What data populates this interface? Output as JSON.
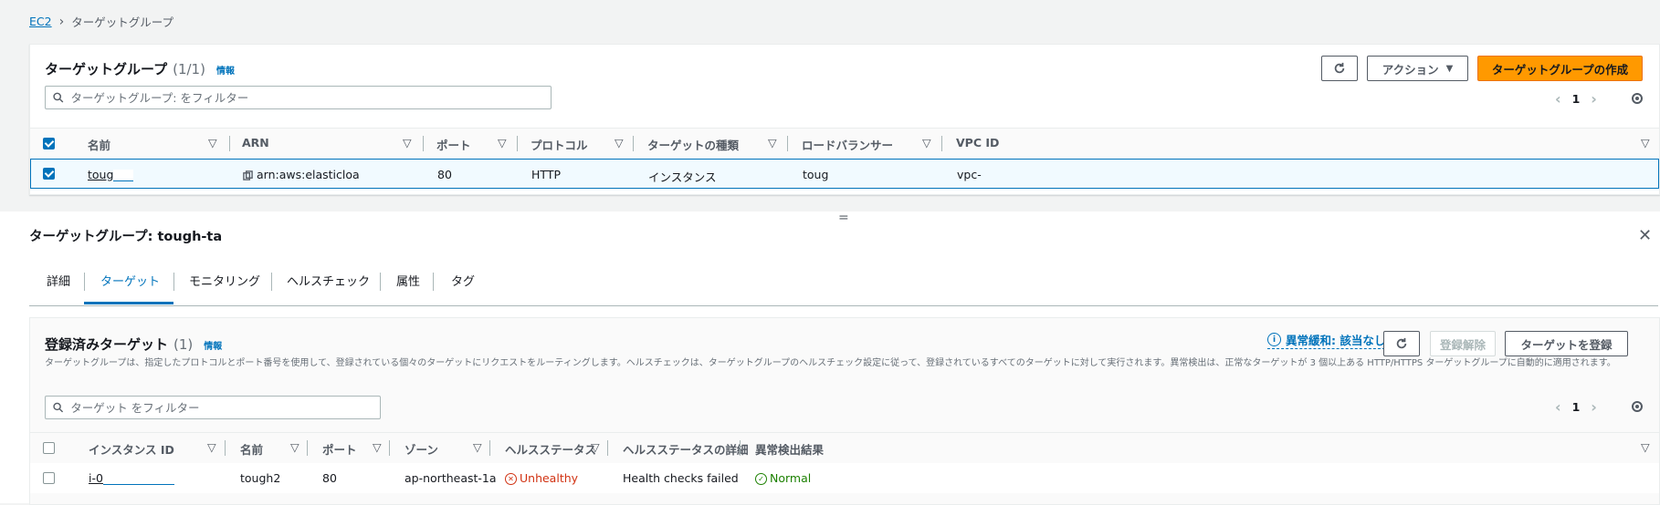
{
  "breadcrumb": {
    "root": "EC2",
    "current": "ターゲットグループ"
  },
  "top": {
    "title": "ターゲットグループ",
    "count": "(1/1)",
    "info": "情報",
    "actions_label": "アクション",
    "create_label": "ターゲットグループの作成",
    "search_placeholder": "ターゲットグループ: をフィルター",
    "page": "1",
    "columns": [
      "名前",
      "ARN",
      "ポート",
      "プロトコル",
      "ターゲットの種類",
      "ロードバランサー",
      "VPC ID"
    ],
    "row": {
      "name": "toug",
      "arn": "arn:aws:elasticloa",
      "port": "80",
      "protocol": "HTTP",
      "target_type": "インスタンス",
      "lb": "toug",
      "vpc": "vpc-"
    }
  },
  "detail": {
    "title": "ターゲットグループ: tough-ta",
    "tabs": [
      "詳細",
      "ターゲット",
      "モニタリング",
      "ヘルスチェック",
      "属性",
      "タグ"
    ],
    "active_tab": 1
  },
  "targets": {
    "title": "登録済みターゲット",
    "count": "(1)",
    "info": "情報",
    "anomaly": "異常緩和: 該当なし",
    "deregister_label": "登録解除",
    "register_label": "ターゲットを登録",
    "description": "ターゲットグループは、指定したプロトコルとポート番号を使用して、登録されている個々のターゲットにリクエストをルーティングします。ヘルスチェックは、ターゲットグループのヘルスチェック設定に従って、登録されているすべてのターゲットに対して実行されます。異常検出は、正常なターゲットが 3 個以上ある HTTP/HTTPS ターゲットグループに自動的に適用されます。",
    "search_placeholder": "ターゲット をフィルター",
    "page": "1",
    "columns": [
      "インスタンス ID",
      "名前",
      "ポート",
      "ゾーン",
      "ヘルスステータス",
      "ヘルスステータスの詳細",
      "異常検出結果"
    ],
    "row": {
      "instance_id": "i-0",
      "name": "tough2",
      "port": "80",
      "zone": "ap-northeast-1a",
      "health": "Unhealthy",
      "health_detail": "Health checks failed",
      "anomaly_result": "Normal"
    }
  },
  "colors": {
    "accent": "#0073bb",
    "primary_button": "#ff9900",
    "unhealthy": "#d13212",
    "normal": "#1d8102"
  }
}
